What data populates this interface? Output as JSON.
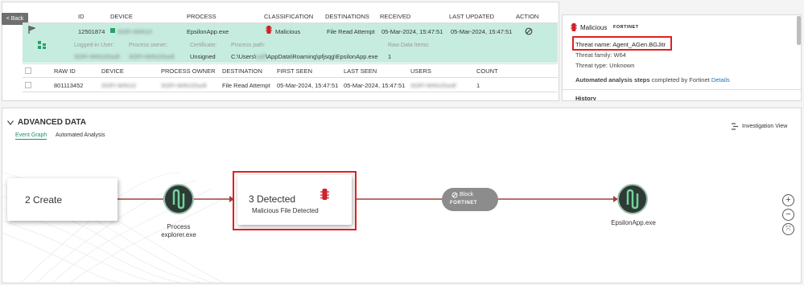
{
  "back_label": "< Back",
  "table": {
    "headers": [
      "ID",
      "DEVICE",
      "PROCESS",
      "CLASSIFICATION",
      "DESTINATIONS",
      "RECEIVED",
      "LAST UPDATED",
      "ACTION"
    ],
    "row": {
      "id": "12501874",
      "device": "SOFI-WIN10",
      "process": "EpsilonApp.exe",
      "classification": "Malicious",
      "destination": "File Read Attempt",
      "received": "05-Mar-2024, 15:47:51",
      "last_updated": "05-Mar-2024, 15:47:51"
    },
    "details": {
      "logged_in_label": "Logged-in User:",
      "logged_in_value": "SOFI-WIN10\\sofi",
      "owner_label": "Process owner:",
      "owner_value": "SOFI-WIN10\\sofi",
      "cert_label": "Certificate:",
      "cert_value": "Unsigned",
      "path_label": "Process path:",
      "path_prefix": "C:\\Users\\",
      "path_blur": "sofi",
      "path_suffix": "\\AppData\\Roaming\\pfjsqg\\EpsilonApp.exe",
      "raw_label": "Raw Data Items:",
      "raw_value": "1"
    },
    "sub_headers": [
      "RAW ID",
      "DEVICE",
      "PROCESS OWNER",
      "DESTINATION",
      "FIRST SEEN",
      "LAST SEEN",
      "USERS",
      "COUNT"
    ],
    "sub_row": {
      "raw_id": "801113452",
      "device": "SOFI-WIN10",
      "owner": "SOFI-WIN10\\sofi",
      "destination": "File Read Attempt",
      "first_seen": "05-Mar-2024, 15:47:51",
      "last_seen": "05-Mar-2024, 15:47:51",
      "users": "SOFI-WIN10\\sofi",
      "count": "1"
    }
  },
  "side": {
    "classification": "Malicious",
    "vendor": "FORTINET",
    "threat_name": "Threat name: Agent_AGen.BGJitr",
    "threat_family": "Threat family: W64",
    "threat_type": "Threat type: Unknown",
    "auto_prefix": "Automated analysis steps",
    "auto_mid": " completed by Fortinet ",
    "auto_link": "Details",
    "history": "History"
  },
  "advanced": {
    "title": "ADVANCED DATA",
    "tabs": [
      "Event Graph",
      "Automated Analysis"
    ],
    "investigation": "Investigation View",
    "nodes": {
      "create": "2 Create",
      "process_name": "Process explorer.exe",
      "detected_title": "3 Detected",
      "detected_sub": "Malicious File Detected",
      "block_label": "Block",
      "block_vendor": "FORTINET",
      "target_name": "EpsilonApp.exe"
    }
  },
  "colors": {
    "accent": "#1f8f6a",
    "row_highlight": "#c6ecdf",
    "danger": "#d0202a",
    "edge": "#a0403a"
  }
}
